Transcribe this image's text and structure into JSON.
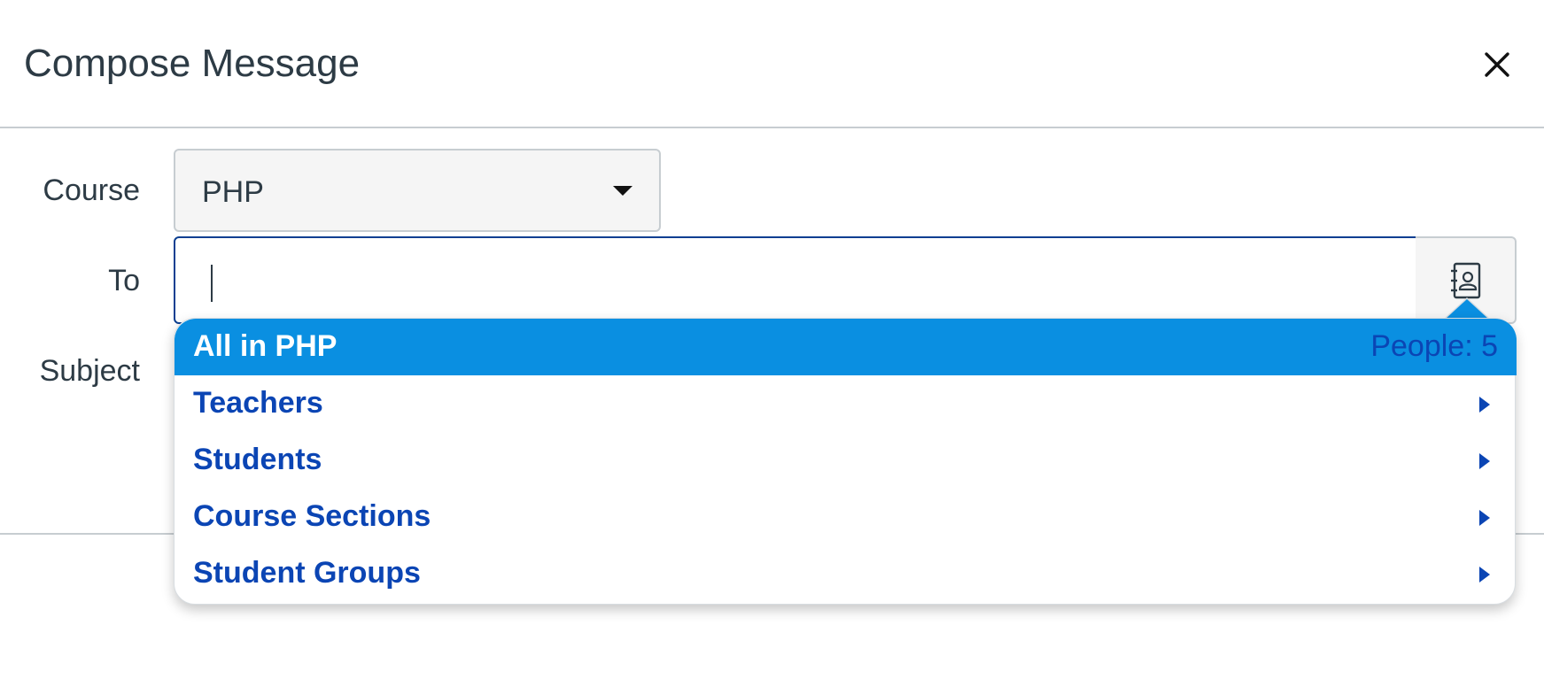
{
  "dialog": {
    "title": "Compose Message",
    "close_icon": "close-icon"
  },
  "form": {
    "course": {
      "label": "Course",
      "value": "PHP"
    },
    "to": {
      "label": "To",
      "value": "",
      "addressbook_icon": "address-book-icon"
    },
    "subject": {
      "label": "Subject"
    }
  },
  "dropdown": {
    "items": [
      {
        "label": "All in PHP",
        "count": "People: 5",
        "selected": true
      },
      {
        "label": "Teachers",
        "has_submenu": true
      },
      {
        "label": "Students",
        "has_submenu": true
      },
      {
        "label": "Course Sections",
        "has_submenu": true
      },
      {
        "label": "Student Groups",
        "has_submenu": true
      }
    ]
  },
  "colors": {
    "text": "#2d3b45",
    "link": "#0b45b4",
    "highlight": "#0a8fe1",
    "focus_border": "#0b3f91",
    "field_bg": "#f5f5f5",
    "border": "#c7cdd1"
  }
}
